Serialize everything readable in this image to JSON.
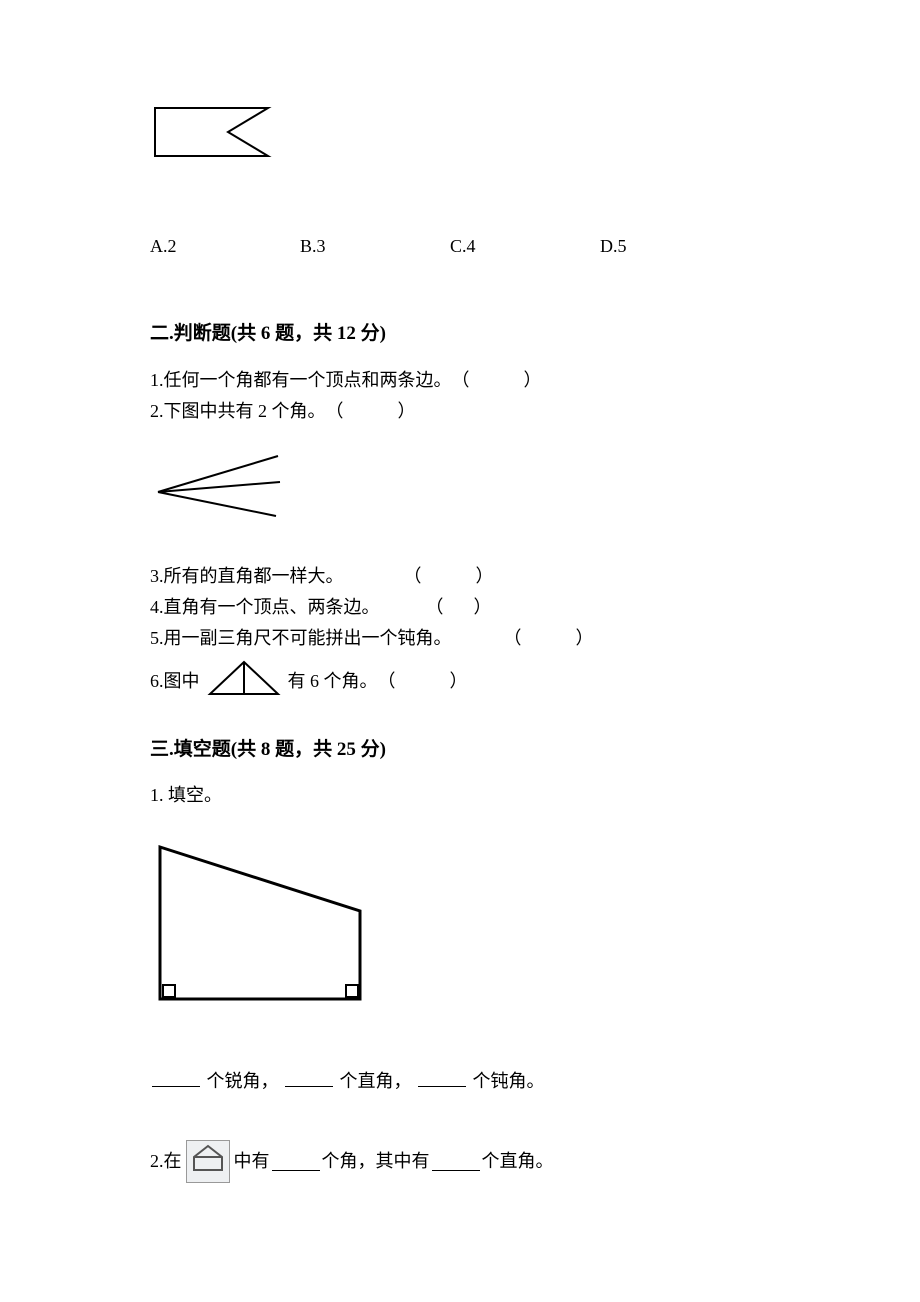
{
  "mcq_options": {
    "a": "A.2",
    "b": "B.3",
    "c": "C.4",
    "d": "D.5"
  },
  "section2": {
    "title": "二.判断题(共 6 题，共 12 分)",
    "q1": {
      "num": "1.",
      "text": "任何一个角都有一个顶点和两条边。",
      "paren": "（　　）"
    },
    "q2": {
      "num": "2.",
      "text": "下图中共有 2 个角。",
      "paren": "（　　）"
    },
    "q3": {
      "num": "3.",
      "text": "所有的直角都一样大。",
      "paren": "（　　）"
    },
    "q4": {
      "num": "4.",
      "text": "直角有一个顶点、两条边。",
      "paren": "（　）"
    },
    "q5": {
      "num": "5.",
      "text": "用一副三角尺不可能拼出一个钝角。",
      "paren": "（　　）"
    },
    "q6": {
      "num": "6.",
      "pre": "图中",
      "post": "有 6 个角。",
      "paren": "（　　）"
    }
  },
  "section3": {
    "title": "三.填空题(共 8 题，共 25 分)",
    "q1": {
      "num": "1.",
      "text": "填空。",
      "tail_a": "个锐角，",
      "tail_b": "个直角，",
      "tail_c": "个钝角。"
    },
    "q2": {
      "num": "2.",
      "pre": "在",
      "mid1": "中有",
      "mid2": "个角，其中有",
      "tail": "个直角。"
    }
  }
}
